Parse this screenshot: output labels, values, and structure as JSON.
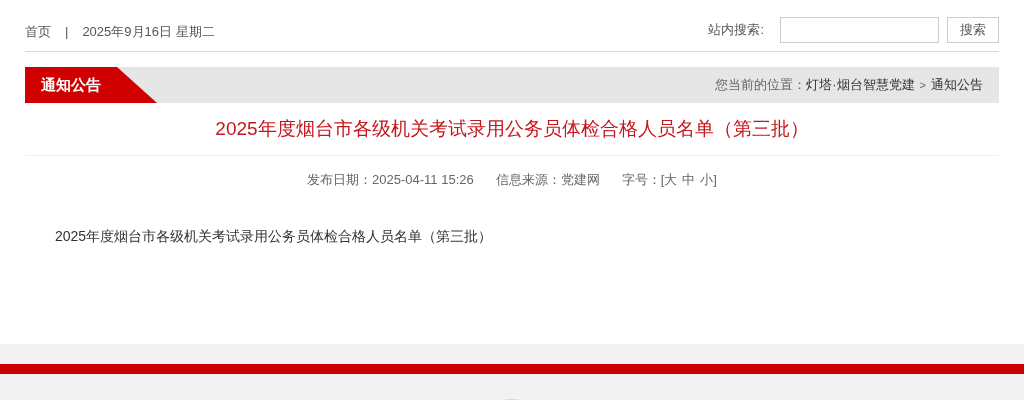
{
  "top_bar": {
    "home_link": "首页",
    "separator": "|",
    "date": "2025年9月16日 星期二",
    "search": {
      "label": "站内搜索:",
      "button": "搜索"
    }
  },
  "banner": {
    "title": "通知公告",
    "location_label": "您当前的位置：",
    "breadcrumb": [
      "灯塔·烟台智慧党建",
      "通知公告"
    ],
    "breadcrumb_separator": ">"
  },
  "article": {
    "title": "2025年度烟台市各级机关考试录用公务员体检合格人员名单（第三批）",
    "meta": {
      "date": "发布日期：2025-04-11 15:26",
      "source": "信息来源：党建网",
      "font_size_label": "字号：",
      "open": "[",
      "options": [
        "大",
        "中",
        "小"
      ],
      "close": "]"
    },
    "body": "2025年度烟台市各级机关考试录用公务员体检合格人员名单（第三批）"
  }
}
